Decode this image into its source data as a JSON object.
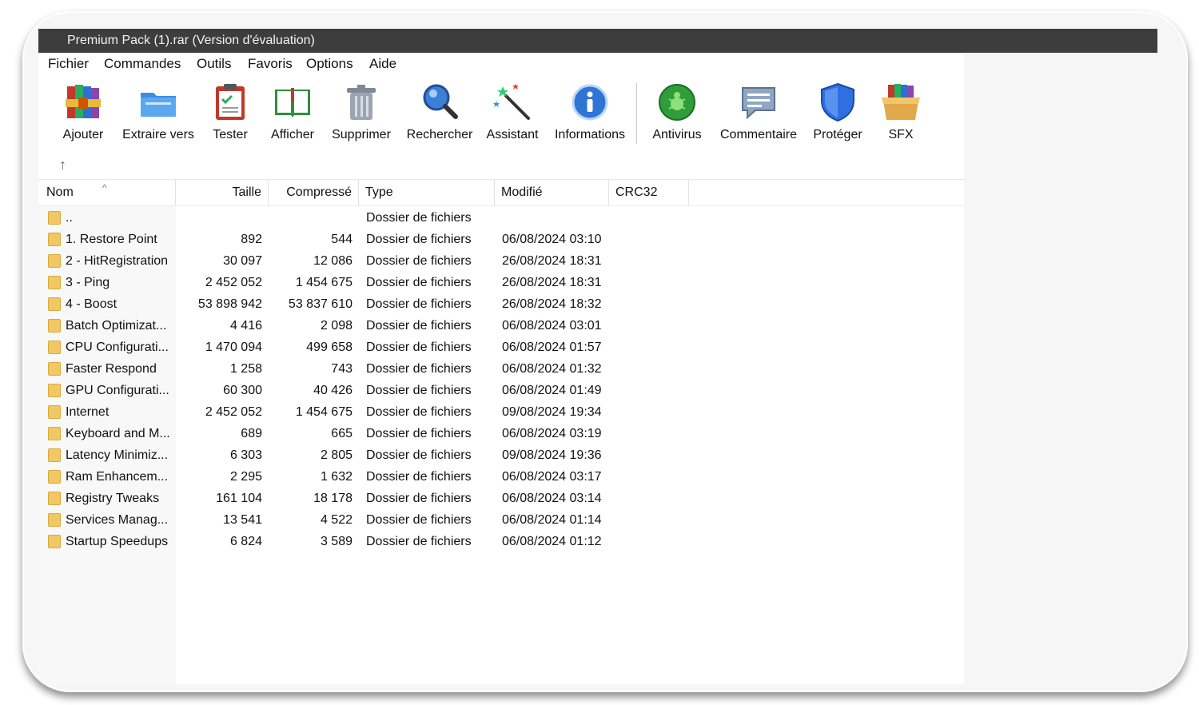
{
  "window": {
    "title": "Premium Pack (1).rar (Version d'évaluation)"
  },
  "menu": [
    "Fichier",
    "Commandes",
    "Outils",
    "Favoris",
    "Options",
    "Aide"
  ],
  "toolbar": [
    {
      "label": "Ajouter",
      "icon": "books-add-icon"
    },
    {
      "label": "Extraire vers",
      "icon": "folder-extract-icon"
    },
    {
      "label": "Tester",
      "icon": "clipboard-check-icon"
    },
    {
      "label": "Afficher",
      "icon": "book-view-icon"
    },
    {
      "label": "Supprimer",
      "icon": "trash-icon"
    },
    {
      "label": "Rechercher",
      "icon": "magnifier-icon"
    },
    {
      "label": "Assistant",
      "icon": "magic-wand-icon"
    },
    {
      "label": "Informations",
      "icon": "info-icon"
    },
    {
      "label": "Antivirus",
      "icon": "antivirus-icon"
    },
    {
      "label": "Commentaire",
      "icon": "comment-icon"
    },
    {
      "label": "Protéger",
      "icon": "shield-icon"
    },
    {
      "label": "SFX",
      "icon": "sfx-box-icon"
    }
  ],
  "columns": [
    "Nom",
    "Taille",
    "Compressé",
    "Type",
    "Modifié",
    "CRC32"
  ],
  "rows": [
    {
      "name": "..",
      "size": "",
      "packed": "",
      "type": "Dossier de fichiers",
      "modified": ""
    },
    {
      "name": "1. Restore Point",
      "size": "892",
      "packed": "544",
      "type": "Dossier de fichiers",
      "modified": "06/08/2024 03:10"
    },
    {
      "name": "2 - HitRegistration",
      "size": "30 097",
      "packed": "12 086",
      "type": "Dossier de fichiers",
      "modified": "26/08/2024 18:31"
    },
    {
      "name": "3 - Ping",
      "size": "2 452 052",
      "packed": "1 454 675",
      "type": "Dossier de fichiers",
      "modified": "26/08/2024 18:31"
    },
    {
      "name": "4 - Boost",
      "size": "53 898 942",
      "packed": "53 837 610",
      "type": "Dossier de fichiers",
      "modified": "26/08/2024 18:32"
    },
    {
      "name": "Batch Optimizat...",
      "size": "4 416",
      "packed": "2 098",
      "type": "Dossier de fichiers",
      "modified": "06/08/2024 03:01"
    },
    {
      "name": "CPU Configurati...",
      "size": "1 470 094",
      "packed": "499 658",
      "type": "Dossier de fichiers",
      "modified": "06/08/2024 01:57"
    },
    {
      "name": "Faster Respond",
      "size": "1 258",
      "packed": "743",
      "type": "Dossier de fichiers",
      "modified": "06/08/2024 01:32"
    },
    {
      "name": "GPU Configurati...",
      "size": "60 300",
      "packed": "40 426",
      "type": "Dossier de fichiers",
      "modified": "06/08/2024 01:49"
    },
    {
      "name": "Internet",
      "size": "2 452 052",
      "packed": "1 454 675",
      "type": "Dossier de fichiers",
      "modified": "09/08/2024 19:34"
    },
    {
      "name": "Keyboard and M...",
      "size": "689",
      "packed": "665",
      "type": "Dossier de fichiers",
      "modified": "06/08/2024 03:19"
    },
    {
      "name": "Latency Minimiz...",
      "size": "6 303",
      "packed": "2 805",
      "type": "Dossier de fichiers",
      "modified": "09/08/2024 19:36"
    },
    {
      "name": "Ram Enhancem...",
      "size": "2 295",
      "packed": "1 632",
      "type": "Dossier de fichiers",
      "modified": "06/08/2024 03:17"
    },
    {
      "name": "Registry Tweaks",
      "size": "161 104",
      "packed": "18 178",
      "type": "Dossier de fichiers",
      "modified": "06/08/2024 03:14"
    },
    {
      "name": "Services Manag...",
      "size": "13 541",
      "packed": "4 522",
      "type": "Dossier de fichiers",
      "modified": "06/08/2024 01:14"
    },
    {
      "name": "Startup Speedups",
      "size": "6 824",
      "packed": "3 589",
      "type": "Dossier de fichiers",
      "modified": "06/08/2024 01:12"
    }
  ]
}
